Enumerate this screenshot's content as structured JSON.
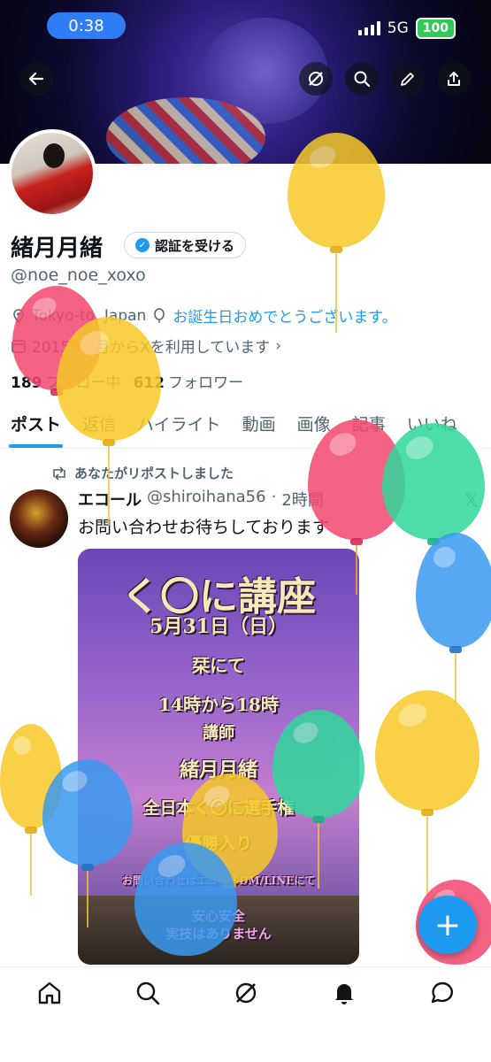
{
  "status_bar": {
    "time": "0:38",
    "network": "5G",
    "battery": "100"
  },
  "profile": {
    "display_name": "緒月月緒",
    "verify_button": "認証を受ける",
    "handle": "@noe_noe_xoxo",
    "location": "Tokyo-to, Japan",
    "birthday_text": "お誕生日おめでとうございます。",
    "joined_text": "2015年2月からXを利用しています",
    "following_count": "189",
    "following_label": "フォロー中",
    "followers_count": "612",
    "followers_label": "フォロワー"
  },
  "tabs": [
    {
      "label": "ポスト",
      "active": true
    },
    {
      "label": "返信"
    },
    {
      "label": "ハイライト"
    },
    {
      "label": "動画"
    },
    {
      "label": "画像"
    },
    {
      "label": "記事"
    },
    {
      "label": "いいね"
    }
  ],
  "post": {
    "repost_text": "あなたがリポストしました",
    "author_name": "エコール",
    "author_handle": "@shiroihana56",
    "time": "2時間",
    "text": "お問い合わせお待ちしております",
    "image_lines": {
      "title": "く〇に講座",
      "date": "5月31日（日）",
      "place": "栞にて",
      "hours": "14時から18時",
      "instructor_label": "講師",
      "instructor_name": "緒月月緒",
      "award": "全日本く〇に選手権",
      "award2": "優勝入り",
      "contact": "お問い合わせはエコールDM/LINEにて",
      "safe": "安心安全",
      "no_practice": "実技はありません"
    }
  },
  "fab_label": "+",
  "colors": {
    "accent": "#1d9bf0",
    "text_secondary": "#536471",
    "verified": "#1d9bf0"
  },
  "icons": [
    "back-arrow-icon",
    "grok-icon",
    "search-icon",
    "edit-icon",
    "share-icon",
    "home-icon",
    "explore-icon",
    "notifications-icon",
    "messages-icon"
  ]
}
